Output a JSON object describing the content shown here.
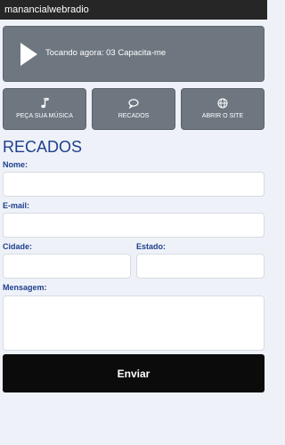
{
  "app": {
    "title": "manancialwebradio"
  },
  "player": {
    "now_playing": "Tocando agora: 03 Capacita-me"
  },
  "buttons": [
    {
      "label": "PEÇA SUA MÚSICA",
      "icon": "music-note-icon"
    },
    {
      "label": "RECADOS",
      "icon": "chat-bubble-icon"
    },
    {
      "label": "ABRIR O SITE",
      "icon": "globe-icon"
    }
  ],
  "form": {
    "title": "RECADOS",
    "nome_label": "Nome:",
    "email_label": "E-mail:",
    "cidade_label": "Cidade:",
    "estado_label": "Estado:",
    "mensagem_label": "Mensagem:",
    "nome_value": "",
    "email_value": "",
    "cidade_value": "",
    "estado_value": "",
    "mensagem_value": "",
    "submit_label": "Enviar"
  },
  "colors": {
    "background": "#eef2f8",
    "tile": "#6e7780",
    "label_blue": "#1f3e8c",
    "submit": "#0b0b0b"
  }
}
